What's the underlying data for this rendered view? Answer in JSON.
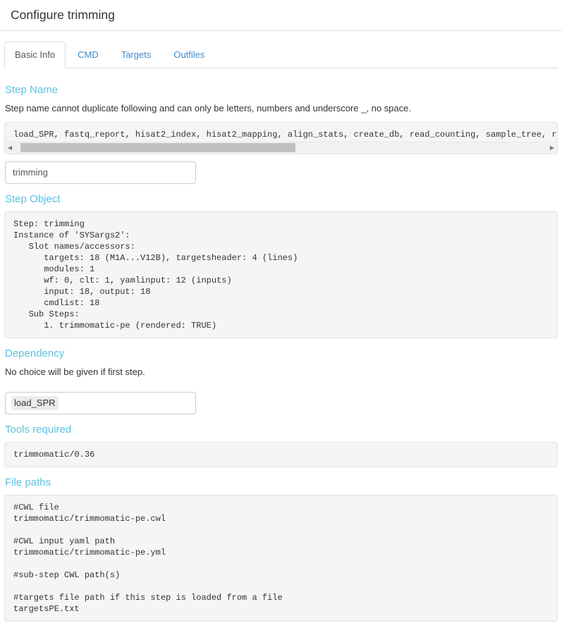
{
  "header": {
    "title": "Configure trimming"
  },
  "tabs": [
    {
      "label": "Basic Info",
      "active": true
    },
    {
      "label": "CMD",
      "active": false
    },
    {
      "label": "Targets",
      "active": false
    },
    {
      "label": "Outfiles",
      "active": false
    }
  ],
  "sections": {
    "step_name": {
      "heading": "Step Name",
      "help_text": "Step name cannot duplicate following and can only be letters, numbers and underscore _, no space.",
      "existing_names_code": "load_SPR, fastq_report, hisat2_index, hisat2_mapping, align_stats, create_db, read_counting, sample_tree, run_",
      "input_value": "trimming",
      "input_placeholder": "",
      "scroll_left_arrow": "◀",
      "scroll_right_arrow": "▶"
    },
    "step_object": {
      "heading": "Step Object",
      "code": "Step: trimming\nInstance of 'SYSargs2':\n   Slot names/accessors:\n      targets: 18 (M1A...V12B), targetsheader: 4 (lines)\n      modules: 1\n      wf: 0, clt: 1, yamlinput: 12 (inputs)\n      input: 18, output: 18\n      cmdlist: 18\n   Sub Steps:\n      1. trimmomatic-pe (rendered: TRUE)"
    },
    "dependency": {
      "heading": "Dependency",
      "help_text": "No choice will be given if first step.",
      "selected_value": "load_SPR"
    },
    "tools_required": {
      "heading": "Tools required",
      "code": "trimmomatic/0.36"
    },
    "file_paths": {
      "heading": "File paths",
      "code": "#CWL file\ntrimmomatic/trimmomatic-pe.cwl\n\n#CWL input yaml path\ntrimmomatic/trimmomatic-pe.yml\n\n#sub-step CWL path(s)\n\n#targets file path if this step is loaded from a file\ntargetsPE.txt"
    }
  },
  "colors": {
    "heading_blue": "#5bc0de",
    "link_blue": "#428bca",
    "code_bg": "#f5f5f5",
    "border": "#dddddd"
  }
}
